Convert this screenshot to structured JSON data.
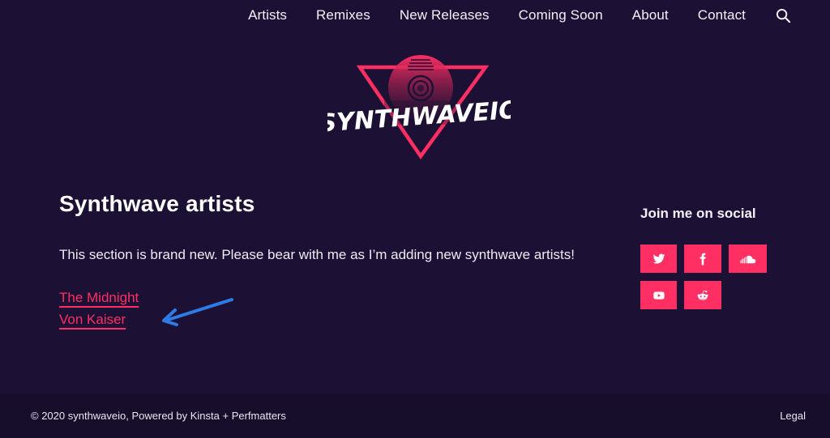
{
  "nav": {
    "items": [
      {
        "label": "Artists"
      },
      {
        "label": "Remixes"
      },
      {
        "label": "New Releases"
      },
      {
        "label": "Coming Soon"
      },
      {
        "label": "About"
      },
      {
        "label": "Contact"
      }
    ],
    "search_icon": "search-icon"
  },
  "logo": {
    "text": "SYNTHWAVEIO",
    "colors": {
      "triangle": "#ff2e63",
      "disc_top": "#ff2e63",
      "disc_bottom": "#7a1a4a",
      "text": "#ffffff"
    }
  },
  "main": {
    "title": "Synthwave artists",
    "intro": "This section is brand new. Please bear with me as I’m adding new synthwave artists!",
    "artists": [
      {
        "label": "The Midnight"
      },
      {
        "label": "Von Kaiser"
      }
    ]
  },
  "sidebar": {
    "title": "Join me on social",
    "social": [
      {
        "name": "twitter",
        "icon": "twitter-icon"
      },
      {
        "name": "facebook",
        "icon": "facebook-icon"
      },
      {
        "name": "soundcloud",
        "icon": "soundcloud-icon"
      },
      {
        "name": "youtube",
        "icon": "youtube-icon"
      },
      {
        "name": "reddit",
        "icon": "reddit-icon"
      }
    ]
  },
  "footer": {
    "copyright": "© 2020 synthwaveio, Powered by Kinsta + Perfmatters",
    "legal": "Legal"
  },
  "theme": {
    "background": "#1c1134",
    "footer_background": "#170e2b",
    "accent": "#ff2e63",
    "annotation": "#2f7be6"
  }
}
